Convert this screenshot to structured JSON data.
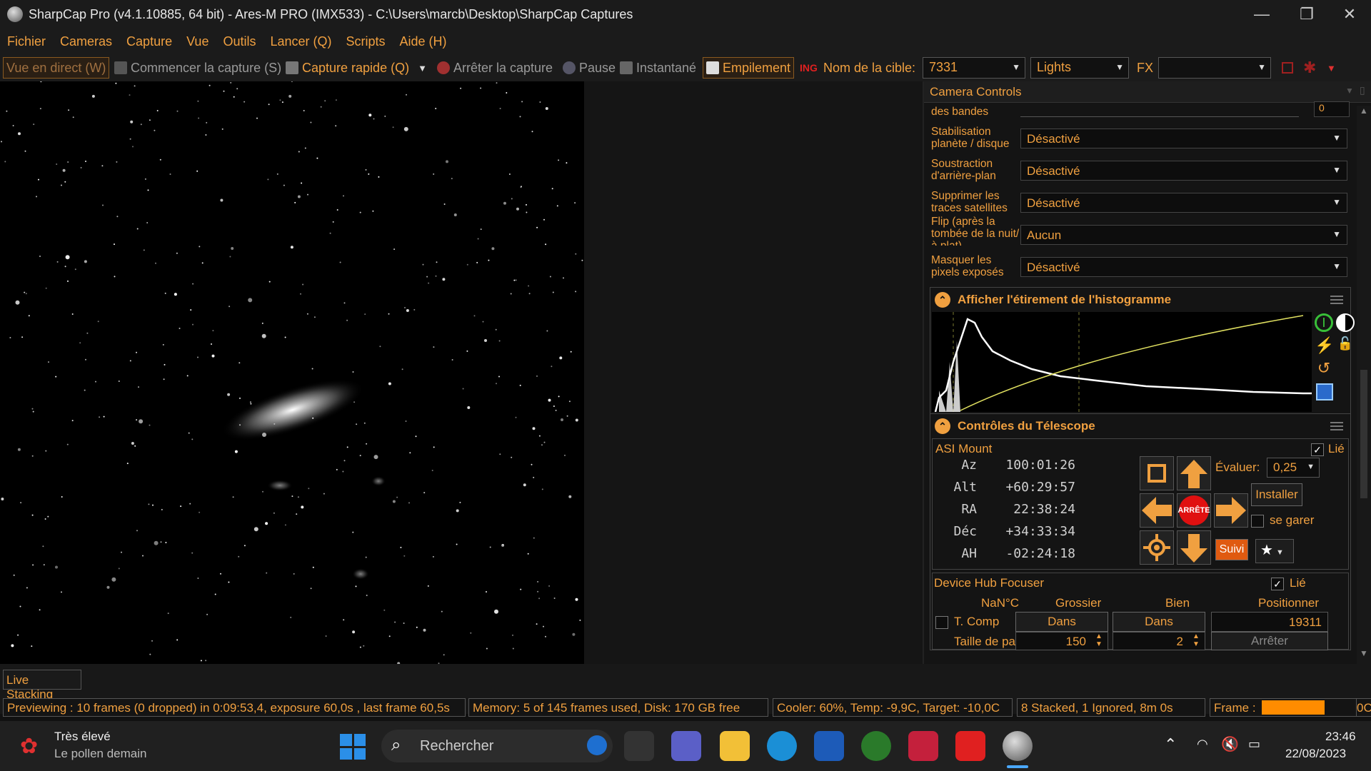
{
  "window": {
    "title": "SharpCap Pro (v4.1.10885, 64 bit) - Ares-M PRO (IMX533) - C:\\Users\\marcb\\Desktop\\SharpCap Captures",
    "min": "—",
    "restore": "❐",
    "close": "✕"
  },
  "menu": [
    "Fichier",
    "Cameras",
    "Capture",
    "Vue",
    "Outils",
    "Lancer (Q)",
    "Scripts",
    "Aide (H)"
  ],
  "toolbar": {
    "live_view": "Vue en direct (W)",
    "start_capture": "Commencer la capture (S)",
    "quick_capture": "Capture rapide (Q)",
    "stop_capture": "Arrêter la capture",
    "pause": "Pause",
    "snapshot": "Instantané",
    "stacking": "Empilement",
    "target_label": "Nom de la cible:",
    "target_value": "7331",
    "frame_type": "Lights",
    "fx_label": "FX",
    "fx_value": ""
  },
  "panel": {
    "title": "Camera Controls",
    "band_label": "des bandes",
    "band_value": "0",
    "controls": [
      {
        "label": "Stabilisation planète / disque",
        "value": "Désactivé"
      },
      {
        "label": "Soustraction d'arrière-plan",
        "value": "Désactivé"
      },
      {
        "label": "Supprimer les traces satellites",
        "value": "Désactivé"
      },
      {
        "label": "Flip (après la tombée de la nuit/à plat)",
        "value": "Aucun"
      },
      {
        "label": "Masquer les pixels exposés",
        "value": "Désactivé"
      }
    ],
    "histogram_title": "Afficher l'étirement de l'histogramme",
    "telescope_title": "Contrôles du Télescope",
    "mount": {
      "name": "ASI Mount",
      "linked": "Lié",
      "rows": [
        {
          "k": "Az",
          "v": "100:01:26"
        },
        {
          "k": "Alt",
          "v": "+60:29:57"
        },
        {
          "k": "RA",
          "v": "22:38:24"
        },
        {
          "k": "Déc",
          "v": "+34:33:34"
        },
        {
          "k": "AH",
          "v": "-02:24:18"
        }
      ],
      "stop_label": "ARRÊTE",
      "rate_label": "Évaluer:",
      "rate_value": "0,25",
      "install": "Installer",
      "park": "se garer",
      "track": "Suivi"
    },
    "focuser": {
      "name": "Device Hub Focuser",
      "linked": "Lié",
      "temp": "NaN°C",
      "coarse": "Grossier",
      "fine": "Bien",
      "position": "Positionner",
      "tcomp": "T. Comp",
      "in1": "Dans",
      "in2": "Dans",
      "pos_value": "19311",
      "step_label": "Taille de pas",
      "coarse_step": "150",
      "fine_step": "2",
      "stop": "Arrêter"
    }
  },
  "tab": "Live Stacking",
  "status": {
    "preview": "Previewing : 10 frames (0 dropped) in 0:09:53,4, exposure 60,0s , last frame 60,5s",
    "memory": "Memory: 5 of 145 frames used, Disk: 170 GB free",
    "cooler": "Cooler: 60%, Temp: -9,9C, Target: -10,0C",
    "stacked": "8 Stacked, 1 Ignored, 8m 0s",
    "frame_label": "Frame :",
    "frame_progress": 0.8,
    "frame_tail": "0C"
  },
  "taskbar": {
    "weather_title": "Très élevé",
    "weather_sub": "Le pollen demain",
    "search": "Rechercher",
    "time": "23:46",
    "date": "22/08/2023"
  },
  "colors": {
    "accent": "#f0a040",
    "stop": "#e01010",
    "bg": "#1b1b1b"
  }
}
